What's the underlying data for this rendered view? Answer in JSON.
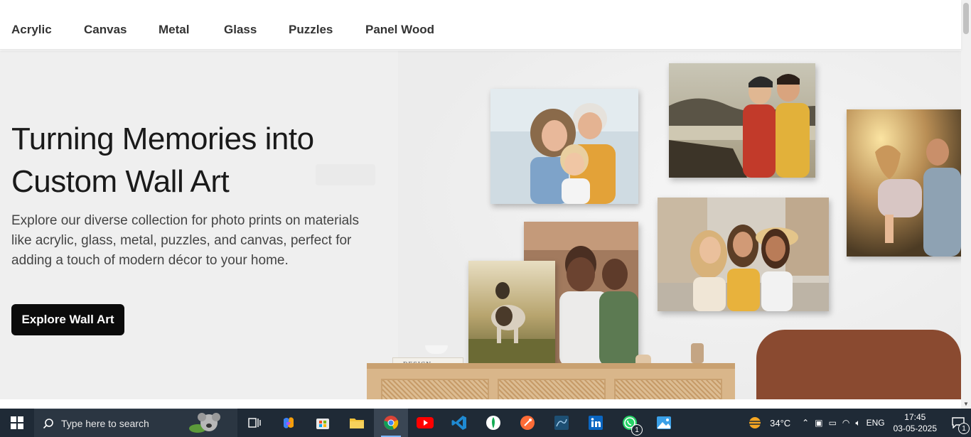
{
  "nav": {
    "items": [
      {
        "label": "Acrylic"
      },
      {
        "label": "Canvas"
      },
      {
        "label": "Metal"
      },
      {
        "label": "Glass"
      },
      {
        "label": "Puzzles"
      },
      {
        "label": "Panel Wood"
      }
    ]
  },
  "hero": {
    "title": "Turning Memories into Custom Wall Art",
    "description": "Explore our diverse collection for photo prints on materials like acrylic, glass, metal, puzzles, and canvas, perfect for adding a touch of modern décor to your home.",
    "cta_label": "Explore Wall Art",
    "book_spine_text": "DESIGN"
  },
  "taskbar": {
    "search_placeholder": "Type here to search",
    "apps": [
      {
        "name": "task-view-icon"
      },
      {
        "name": "copilot-icon"
      },
      {
        "name": "microsoft-store-icon"
      },
      {
        "name": "file-explorer-icon"
      },
      {
        "name": "chrome-icon",
        "active": true
      },
      {
        "name": "youtube-icon"
      },
      {
        "name": "vscode-icon"
      },
      {
        "name": "mongodb-icon"
      },
      {
        "name": "postman-icon"
      },
      {
        "name": "mysql-workbench-icon"
      },
      {
        "name": "linkedin-icon"
      },
      {
        "name": "whatsapp-icon",
        "badge": "1"
      },
      {
        "name": "photos-icon"
      }
    ],
    "weather": "34°C",
    "language": "ENG",
    "time": "17:45",
    "date": "03-05-2025",
    "notification_count": "1"
  },
  "colors": {
    "cta_bg": "#0b0b0b",
    "hero_bg": "#efefef",
    "taskbar_bg": "#1f2a36"
  }
}
